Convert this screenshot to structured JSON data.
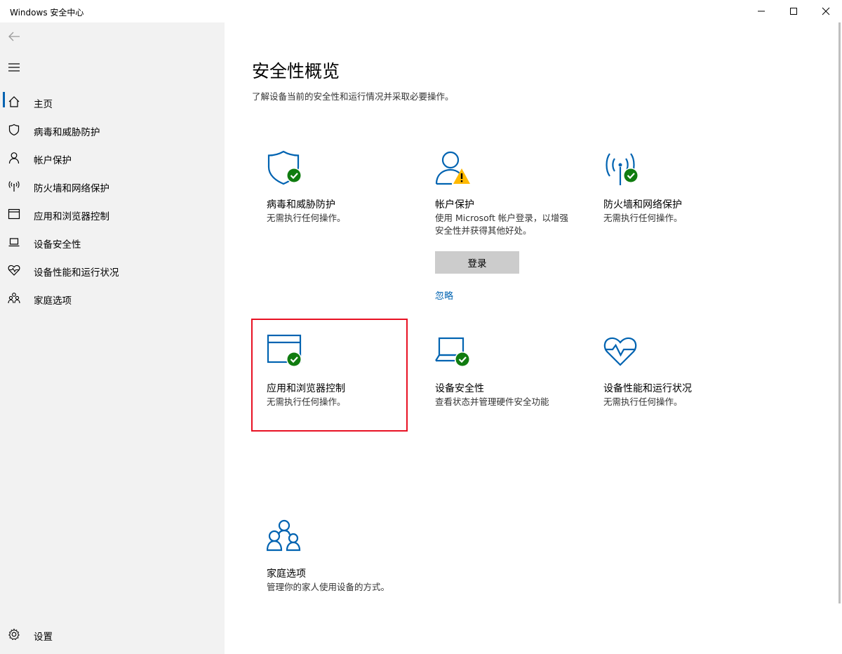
{
  "window": {
    "title": "Windows 安全中心"
  },
  "sidebar": {
    "items": [
      {
        "label": "主页",
        "icon": "home-icon"
      },
      {
        "label": "病毒和威胁防护",
        "icon": "shield-icon"
      },
      {
        "label": "帐户保护",
        "icon": "person-icon"
      },
      {
        "label": "防火墙和网络保护",
        "icon": "antenna-icon"
      },
      {
        "label": "应用和浏览器控制",
        "icon": "browser-window-icon"
      },
      {
        "label": "设备安全性",
        "icon": "laptop-icon"
      },
      {
        "label": "设备性能和运行状况",
        "icon": "heart-icon"
      },
      {
        "label": "家庭选项",
        "icon": "family-icon"
      }
    ],
    "settings_label": "设置"
  },
  "main": {
    "title": "安全性概览",
    "subtitle": "了解设备当前的安全性和运行情况并采取必要操作。",
    "cards": [
      {
        "title": "病毒和威胁防护",
        "desc": "无需执行任何操作。",
        "status": "ok"
      },
      {
        "title": "帐户保护",
        "desc": "使用 Microsoft 帐户登录，以增强安全性并获得其他好处。",
        "status": "warning",
        "button": "登录",
        "link": "忽略"
      },
      {
        "title": "防火墙和网络保护",
        "desc": "无需执行任何操作。",
        "status": "ok"
      },
      {
        "title": "应用和浏览器控制",
        "desc": "无需执行任何操作。",
        "status": "ok"
      },
      {
        "title": "设备安全性",
        "desc": "查看状态并管理硬件安全功能",
        "status": "ok"
      },
      {
        "title": "设备性能和运行状况",
        "desc": "无需执行任何操作。",
        "status": "none"
      },
      {
        "title": "家庭选项",
        "desc": "管理你的家人使用设备的方式。",
        "status": "none"
      }
    ]
  },
  "colors": {
    "accent": "#0063b1",
    "ok_green": "#107c10",
    "warning_yellow": "#ffb900",
    "highlight_red": "#e81123",
    "sidebar_bg": "#f2f2f2"
  }
}
